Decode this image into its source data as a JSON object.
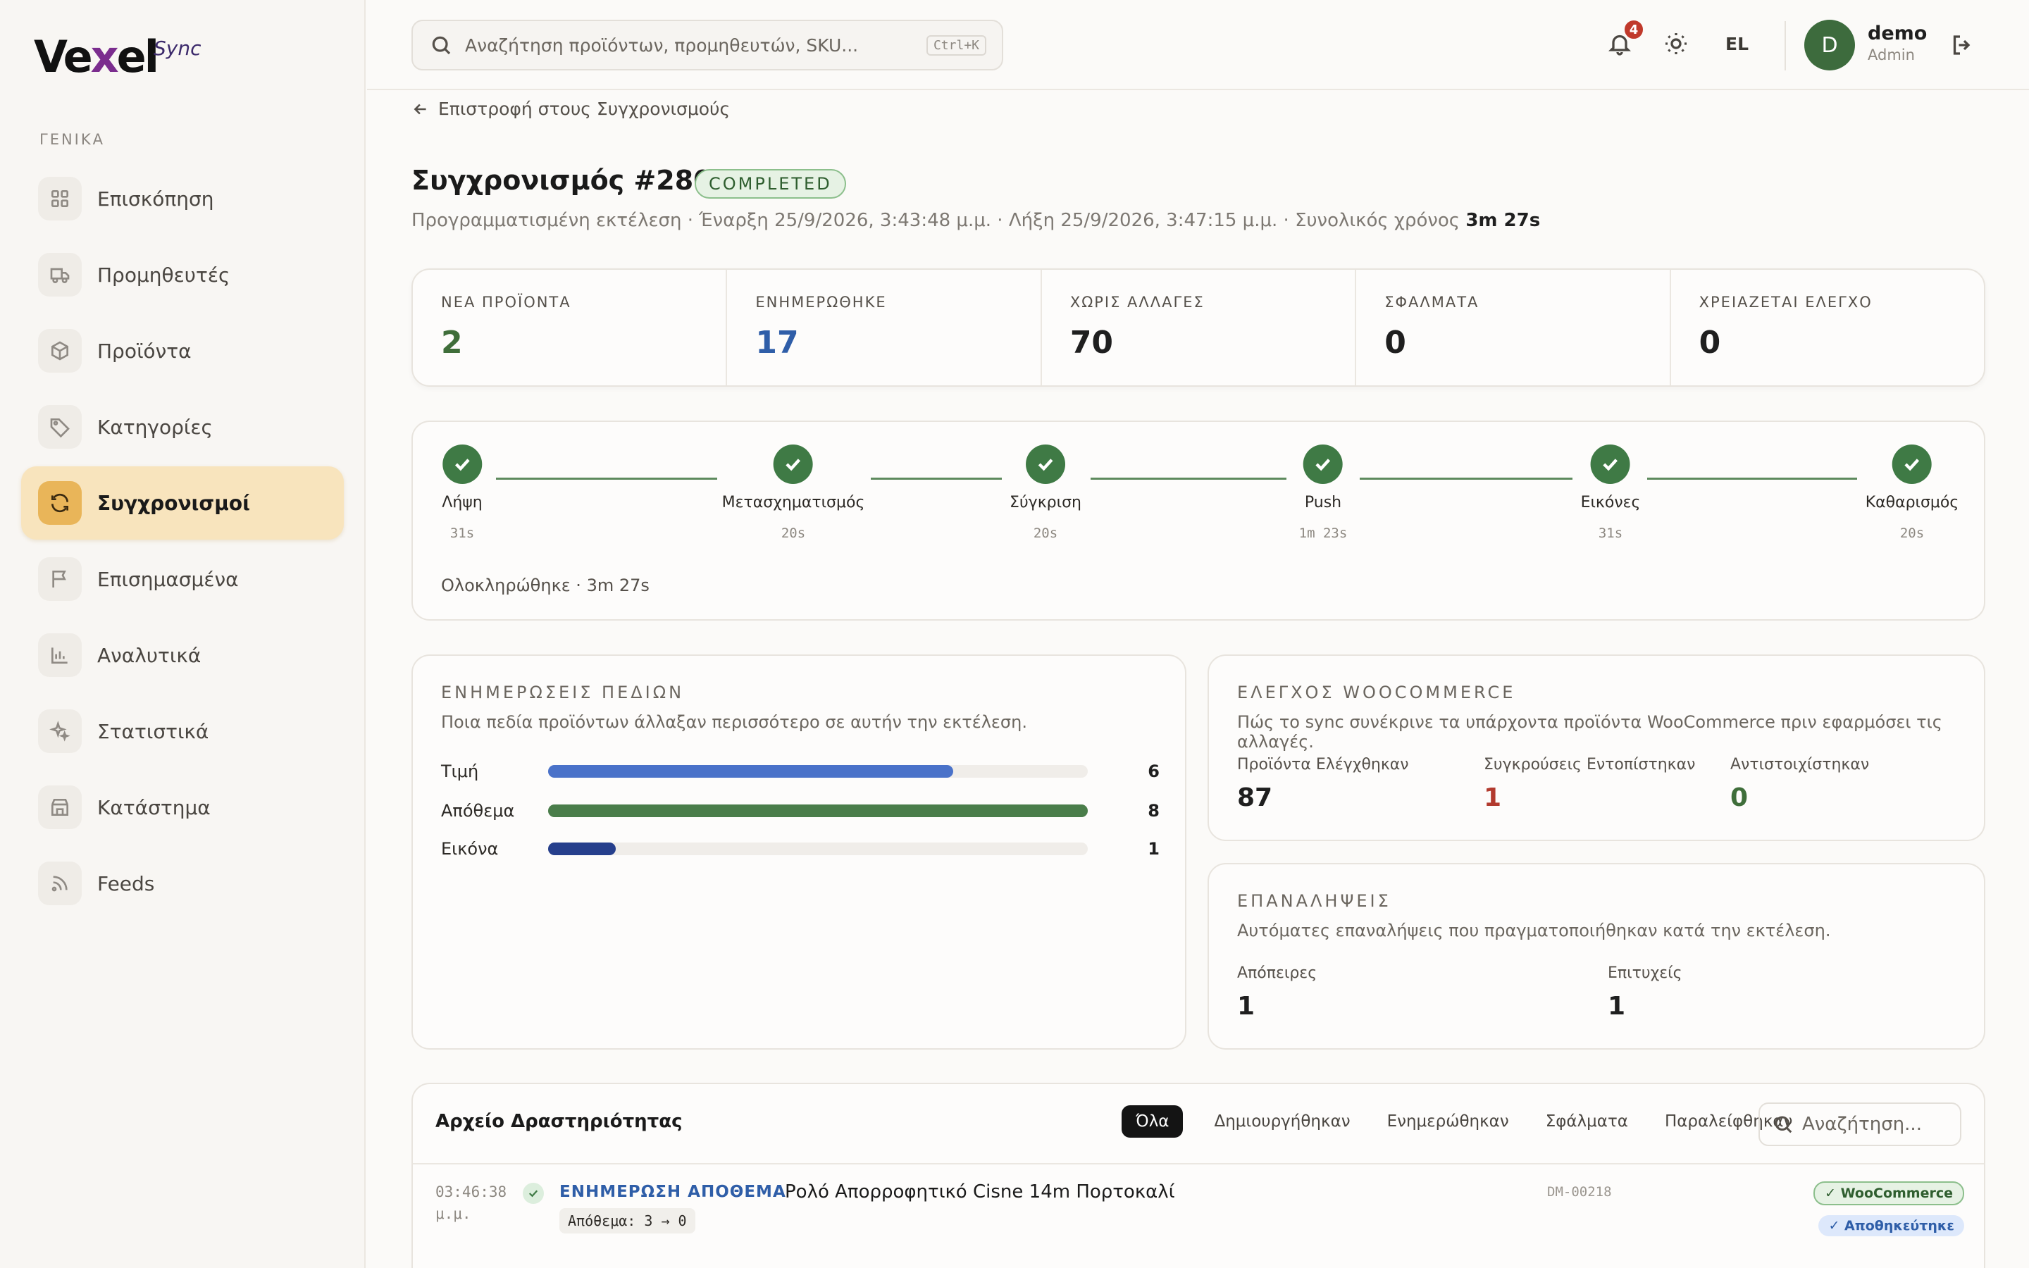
{
  "brand": {
    "name_pre": "Ve",
    "name_x": "x",
    "name_post": "el",
    "suffix": "Sync"
  },
  "sidebar": {
    "section": "ΓΕΝΙΚΑ",
    "items": [
      {
        "label": "Επισκόπηση",
        "icon": "grid-icon"
      },
      {
        "label": "Προμηθευτές",
        "icon": "truck-icon"
      },
      {
        "label": "Προϊόντα",
        "icon": "box-icon"
      },
      {
        "label": "Κατηγορίες",
        "icon": "tag-icon"
      },
      {
        "label": "Συγχρονισμοί",
        "icon": "refresh-icon",
        "active": true
      },
      {
        "label": "Επισημασμένα",
        "icon": "flag-icon"
      },
      {
        "label": "Αναλυτικά",
        "icon": "bar-chart-icon"
      },
      {
        "label": "Στατιστικά",
        "icon": "sparkle-icon"
      },
      {
        "label": "Κατάστημα",
        "icon": "store-icon"
      },
      {
        "label": "Feeds",
        "icon": "rss-icon"
      }
    ]
  },
  "topbar": {
    "search_placeholder": "Αναζήτηση προϊόντων, προμηθευτών, SKU...",
    "shortcut": "Ctrl+K",
    "notifications": "4",
    "language": "EL",
    "user": {
      "initial": "D",
      "name": "demo",
      "role": "Admin"
    }
  },
  "page": {
    "back": "Επιστροφή στους Συγχρονισμούς",
    "title": "Συγχρονισμός #28081",
    "status": "COMPLETED",
    "meta": "Προγραμματισμένη εκτέλεση · Έναρξη 25/9/2026, 3:43:48 μ.μ. · Λήξη 25/9/2026, 3:47:15 μ.μ. · Συνολικός χρόνος",
    "total_time": "3m 27s"
  },
  "stats": [
    {
      "label": "ΝΕΑ ΠΡΟΪΟΝΤΑ",
      "value": "2",
      "color": "#3f6e3a"
    },
    {
      "label": "ΕΝΗΜΕΡΩΘΗΚΕ",
      "value": "17",
      "color": "#2f5ea8"
    },
    {
      "label": "ΧΩΡΙΣ ΑΛΛΑΓΕΣ",
      "value": "70",
      "color": "#1f1f1f"
    },
    {
      "label": "ΣΦΑΛΜΑΤΑ",
      "value": "0",
      "color": "#1f1f1f"
    },
    {
      "label": "ΧΡΕΙΑΖΕΤΑΙ ΕΛΕΓΧΟ",
      "value": "0",
      "color": "#1f1f1f"
    }
  ],
  "pipeline": {
    "steps": [
      {
        "name": "Λήψη",
        "time": "31s"
      },
      {
        "name": "Μετασχηματισμός",
        "time": "20s"
      },
      {
        "name": "Σύγκριση",
        "time": "20s"
      },
      {
        "name": "Push",
        "time": "1m 23s"
      },
      {
        "name": "Εικόνες",
        "time": "31s"
      },
      {
        "name": "Καθαρισμός",
        "time": "20s"
      }
    ],
    "done": "Ολοκληρώθηκε · 3m 27s"
  },
  "field_updates": {
    "title": "ΕΝΗΜΕΡΩΣΕΙΣ ΠΕΔΙΩΝ",
    "subtitle": "Ποια πεδία προϊόντων άλλαξαν περισσότερο σε αυτήν την εκτέλεση.",
    "rows": [
      {
        "label": "Τιμή",
        "value": "6",
        "fraction": 0.75,
        "color": "#4a72c9"
      },
      {
        "label": "Απόθεμα",
        "value": "8",
        "fraction": 1.0,
        "color": "#4a7d4a"
      },
      {
        "label": "Εικόνα",
        "value": "1",
        "fraction": 0.125,
        "color": "#263f8c"
      }
    ]
  },
  "woo_check": {
    "title": "ΕΛΕΓΧΟΣ WOOCOMMERCE",
    "subtitle": "Πώς το sync συνέκρινε τα υπάρχοντα προϊόντα WooCommerce πριν εφαρμόσει τις αλλαγές.",
    "cols": [
      {
        "label": "Προϊόντα Ελέγχθηκαν",
        "value": "87",
        "color": "#1f1f1f"
      },
      {
        "label": "Συγκρούσεις Εντοπίστηκαν",
        "value": "1",
        "color": "#b23a2e"
      },
      {
        "label": "Αντιστοιχίστηκαν",
        "value": "0",
        "color": "#3f6e3a"
      }
    ]
  },
  "retries": {
    "title": "ΕΠΑΝΑΛΗΨΕΙΣ",
    "subtitle": "Αυτόματες επαναλήψεις που πραγματοποιήθηκαν κατά την εκτέλεση.",
    "cols": [
      {
        "label": "Απόπειρες",
        "value": "1"
      },
      {
        "label": "Επιτυχείς",
        "value": "1"
      }
    ]
  },
  "activity": {
    "title": "Αρχείο Δραστηριότητας",
    "filters": [
      "Όλα",
      "Δημιουργήθηκαν",
      "Ενημερώθηκαν",
      "Σφάλματα",
      "Παραλείφθηκαν"
    ],
    "search_placeholder": "Αναζήτηση...",
    "rows": [
      {
        "time": "03:46:38 μ.μ.",
        "type": "ΕΝΗΜΕΡΩΣΗ ΑΠΟΘΕΜΑ",
        "product": "Ρολό Απορροφητικό Cisne 14m Πορτοκαλί",
        "sku": "DM-00218",
        "change": "Απόθεμα: 3 → 0",
        "tag1": "✓ WooCommerce",
        "tag2": "✓ Αποθηκεύτηκε"
      }
    ]
  }
}
